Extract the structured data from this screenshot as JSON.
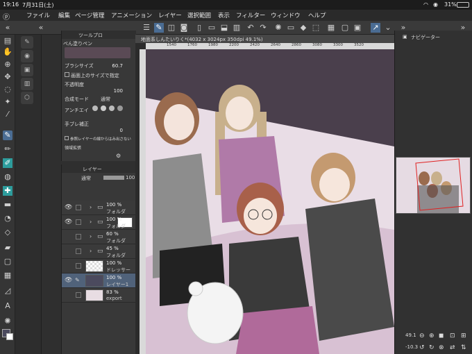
{
  "status": {
    "time": "19:16",
    "date": "7月31日(土)",
    "battery": "31%"
  },
  "menu": [
    "ファイル",
    "編集",
    "ページ管理",
    "アニメーション",
    "レイヤー",
    "選択範囲",
    "表示",
    "フィルター",
    "ウィンドウ",
    "ヘルプ"
  ],
  "canvas_tab": "地面系しんたいりく*(4032 x 3024px 350dpi 49.1%)",
  "ruler_ticks": [
    "1540",
    "1760",
    "1980",
    "2200",
    "2420",
    "2640",
    "2860",
    "3080",
    "3300",
    "3520"
  ],
  "tool_property": {
    "panel_title": "ツールプロ",
    "brush_name": "ぺん塗りペン",
    "brush_size_label": "ブラシサイズ",
    "brush_size": "60.7",
    "screen_size_label": "画面上のサイズで指定",
    "opacity_label": "不透明度",
    "opacity": "100",
    "blend_label": "合成モード",
    "blend": "通常",
    "antialias_label": "アンチエイ",
    "stabilization_label": "手ブレ補正",
    "stabilization": "0",
    "refer_label": "参照レイヤーの線からはみ出さない",
    "expand_label": "領域拡張"
  },
  "layer_panel": {
    "title": "レイヤー",
    "blend": "通常",
    "opacity": "100",
    "layers": [
      {
        "pct": "100 %",
        "name": "フォルダ",
        "type": "folder",
        "visible": true
      },
      {
        "pct": "100 %",
        "name": "フォルダ",
        "type": "folder",
        "visible": true
      },
      {
        "pct": "60 %",
        "name": "フォルダ",
        "type": "folder",
        "visible": false
      },
      {
        "pct": "45 %",
        "name": "フォルダ",
        "type": "folder",
        "visible": false
      },
      {
        "pct": "100 %",
        "name": "ドレッサー",
        "type": "layer",
        "visible": false
      },
      {
        "pct": "100 %",
        "name": "レイヤー1",
        "type": "layer",
        "visible": true,
        "selected": true
      },
      {
        "pct": "83 %",
        "name": "export",
        "type": "layer",
        "visible": false
      }
    ]
  },
  "navigator": {
    "title": "ナビゲーター",
    "zoom": "49.1",
    "rotation": "-10.3"
  }
}
